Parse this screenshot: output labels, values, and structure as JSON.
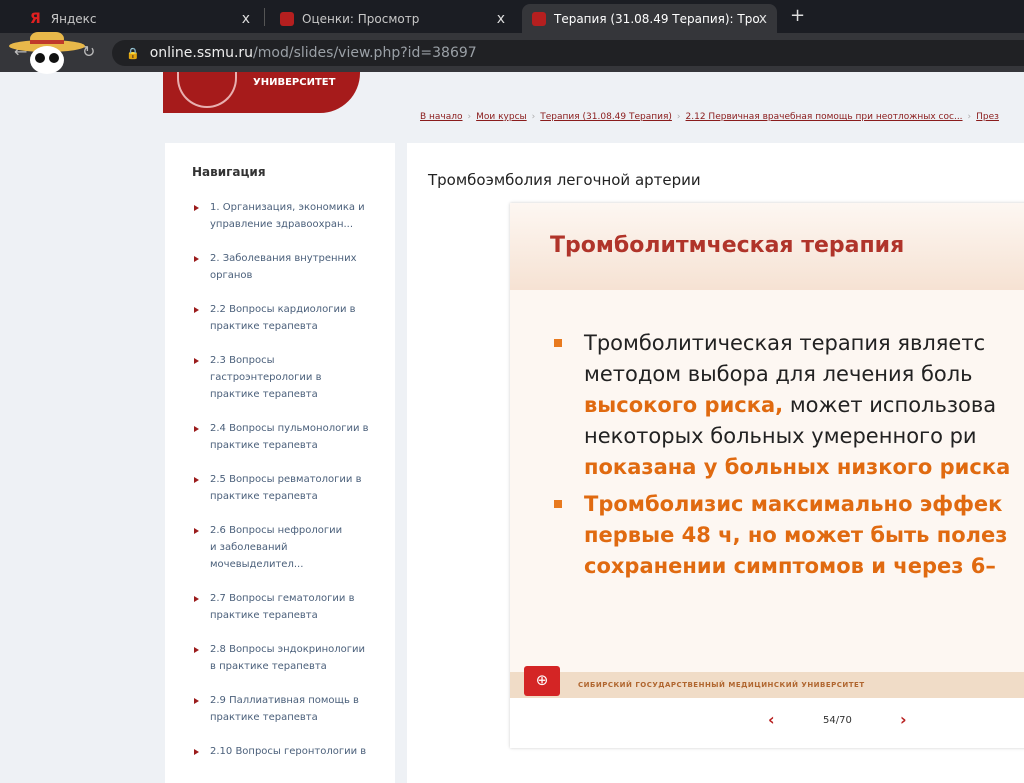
{
  "browser": {
    "tabs": [
      {
        "label": "Яндекс",
        "icon": "Я"
      },
      {
        "label": "Оценки: Просмотр"
      },
      {
        "label": "Терапия (31.08.49 Терапия): Тро"
      }
    ],
    "close": "x",
    "new_tab": "+",
    "url_domain": "online.ssmu.ru",
    "url_path": "/mod/slides/view.php?id=38697"
  },
  "logo": {
    "text": "УНИВЕРСИТЕТ"
  },
  "breadcrumbs": [
    "В начало",
    "Мои курсы",
    "Терапия (31.08.49 Терапия)",
    "2.12 Первичная врачебная помощь при неотложных сос...",
    "През"
  ],
  "sidebar": {
    "title": "Навигация",
    "items": [
      "1. Организация, экономика и управление здравоохран...",
      "2. Заболевания внутренних органов",
      "2.2 Вопросы кардиологии в практике терапевта",
      "2.3 Вопросы гастроэнтерологии в практике терапевта",
      "2.4 Вопросы пульмонологии в практике терапевта",
      "2.5 Вопросы ревматологии в практике терапевта",
      "2.6 Вопросы нефрологии и заболеваний мочевыделител...",
      "2.7 Вопросы гематологии в практике терапевта",
      "2.8 Вопросы эндокринологии в практике терапевта",
      "2.9 Паллиативная помощь в практике терапевта",
      "2.10 Вопросы геронтологии в"
    ]
  },
  "main": {
    "title": "Тромбоэмболия легочной артерии",
    "slide": {
      "heading": "Тромболитмческая терапия",
      "b1": {
        "l1": "Тромболитическая терапия являетс",
        "l2": "методом выбора для лечения боль",
        "l3a": "высокого риска,",
        "l3b": " может использова",
        "l4": "некоторых больных умеренного ри",
        "l5": "показана у больных низкого риска"
      },
      "b2": {
        "l1": "Тромболизис максимально эффек",
        "l2": "первые 48 ч, но может быть полез",
        "l3": "сохранении симптомов и через 6–"
      },
      "footer": "СИБИРСКИЙ ГОСУДАРСТВЕННЫЙ МЕДИЦИНСКИЙ УНИВЕРСИТЕТ"
    },
    "pager": {
      "prev": "‹",
      "next": "›",
      "current": "54/70"
    }
  }
}
